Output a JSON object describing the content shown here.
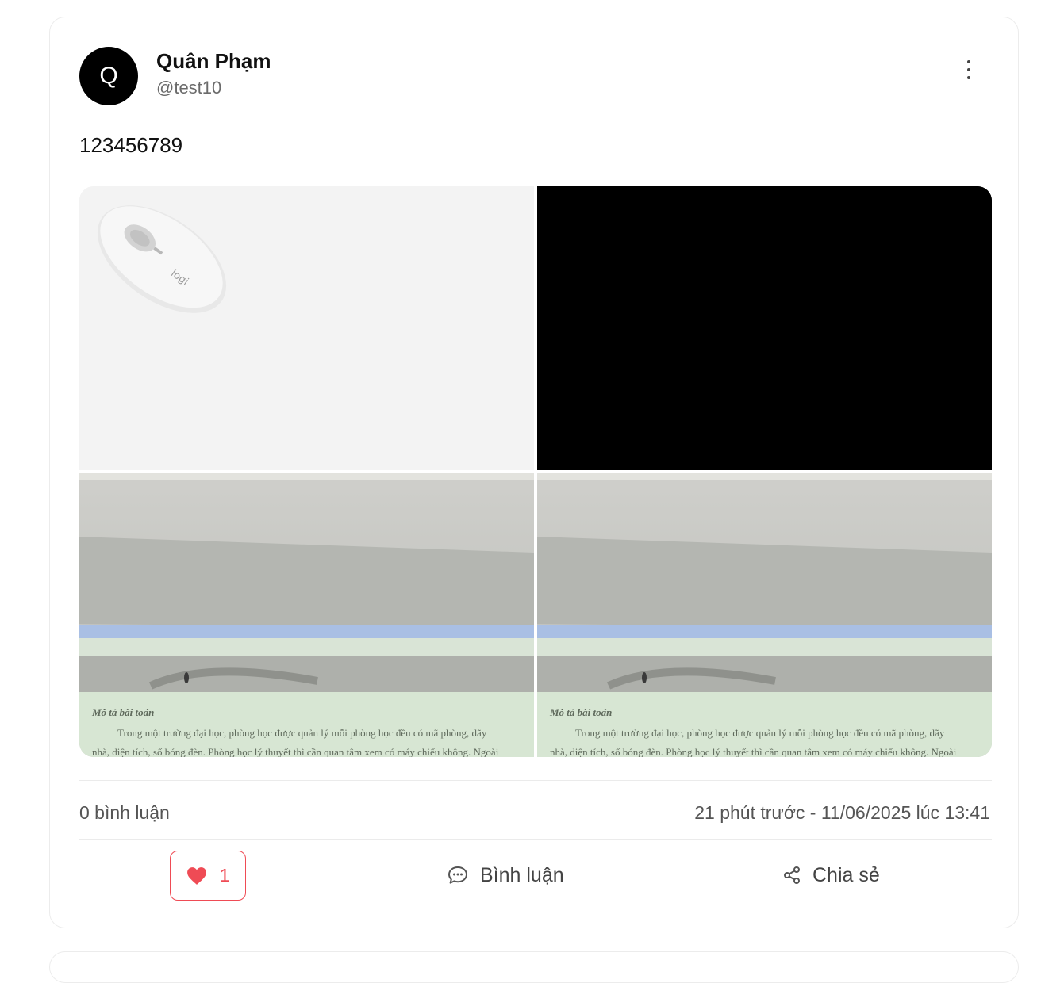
{
  "post": {
    "author": {
      "avatar_initial": "Q",
      "name": "Quân Phạm",
      "handle": "@test10"
    },
    "content": "123456789",
    "images": [
      {
        "icon": "mouse-product-photo"
      },
      {
        "icon": "black-image"
      },
      {
        "icon": "classroom-projector-photo",
        "caption_heading": "Mô tả bài toán",
        "caption_line1": "Trong một trường đại học, phòng học được quản lý mỗi phòng học đều có mã phòng, dãy",
        "caption_line2": "nhà, diện tích, số bóng đèn. Phòng học lý thuyết thì cần quan tâm xem có máy chiếu không. Ngoài"
      },
      {
        "icon": "classroom-projector-photo",
        "caption_heading": "Mô tả bài toán",
        "caption_line1": "Trong một trường đại học, phòng học được quản lý mỗi phòng học đều có mã phòng, dãy",
        "caption_line2": "nhà, diện tích, số bóng đèn. Phòng học lý thuyết thì cần quan tâm xem có máy chiếu không. Ngoài"
      }
    ],
    "stats": {
      "comments": "0 bình luận",
      "timestamp": "21 phút trước - 11/06/2025 lúc 13:41"
    },
    "actions": {
      "like_count": "1",
      "comment_label": "Bình luận",
      "share_label": "Chia sẻ"
    }
  },
  "colors": {
    "like": "#ef4b55",
    "text_muted": "#555555",
    "border": "#ececec"
  }
}
